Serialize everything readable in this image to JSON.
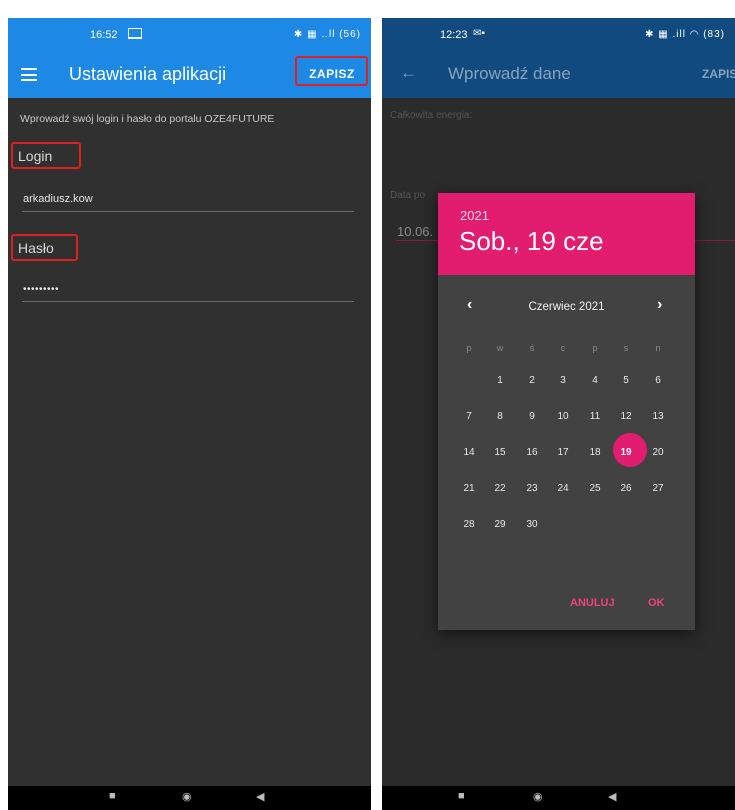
{
  "left_screen": {
    "status_time": "16:52",
    "status_icons": "✱ ▦ ‥ll (56)",
    "menu_icon": "hamburger-icon",
    "title": "Ustawienia aplikacji",
    "save_label": "ZAPISZ",
    "instruction": "Wprowadź swój login i hasło do portalu OZE4FUTURE",
    "login_label": "Login",
    "login_value": "arkadiusz.kow",
    "password_label": "Hasło",
    "password_value": "•••••••••",
    "highlight_color": "#e02020",
    "appbar_color": "#1e88e5"
  },
  "right_screen": {
    "status_time": "12:23",
    "status_icons": "✱ ▦ .ill ◠ (83)",
    "back_icon": "arrow-left-icon",
    "title": "Wprowadź dane",
    "save_label": "ZAPIS",
    "energy_label": "Całkowita energia:",
    "date_label": "Data po",
    "date_value": "10.06.",
    "appbar_color": "#104a7e"
  },
  "date_picker": {
    "year": "2021",
    "selected_date": "Sob., 19 cze",
    "month_label": "Czerwiec 2021",
    "prev_icon": "chevron-left-icon",
    "next_icon": "chevron-right-icon",
    "weekdays": [
      "p",
      "w",
      "ś",
      "c",
      "p",
      "s",
      "n"
    ],
    "weeks": [
      [
        "",
        "1",
        "2",
        "3",
        "4",
        "5",
        "6"
      ],
      [
        "7",
        "8",
        "9",
        "10",
        "11",
        "12",
        "13"
      ],
      [
        "14",
        "15",
        "16",
        "17",
        "18",
        "19",
        "20"
      ],
      [
        "21",
        "22",
        "23",
        "24",
        "25",
        "26",
        "27"
      ],
      [
        "28",
        "29",
        "30",
        "",
        "",
        "",
        ""
      ]
    ],
    "selected_day": "19",
    "cancel_label": "ANULUJ",
    "ok_label": "OK",
    "accent_color": "#e21d6f"
  },
  "navbar": {
    "square": "■",
    "circle": "◉",
    "back": "◀"
  }
}
